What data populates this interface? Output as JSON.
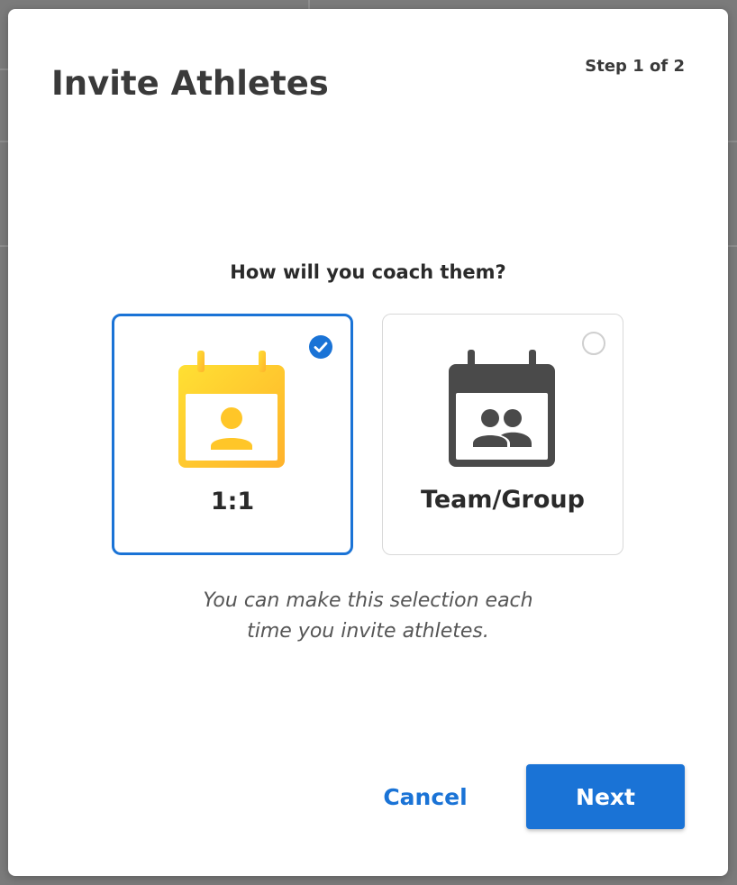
{
  "dialog": {
    "title": "Invite Athletes",
    "step_label": "Step 1 of 2",
    "question": "How will you coach them?",
    "options": [
      {
        "label": "1:1",
        "selected": true,
        "icon": "calendar-person-icon",
        "color": "#ffc107"
      },
      {
        "label": "Team/Group",
        "selected": false,
        "icon": "calendar-group-icon",
        "color": "#4a4a4a"
      }
    ],
    "hint_line1": "You can make this selection each",
    "hint_line2": "time you invite athletes.",
    "cancel_label": "Cancel",
    "next_label": "Next"
  },
  "colors": {
    "accent": "#1a73d6",
    "backdrop": "#7b7b7b"
  }
}
